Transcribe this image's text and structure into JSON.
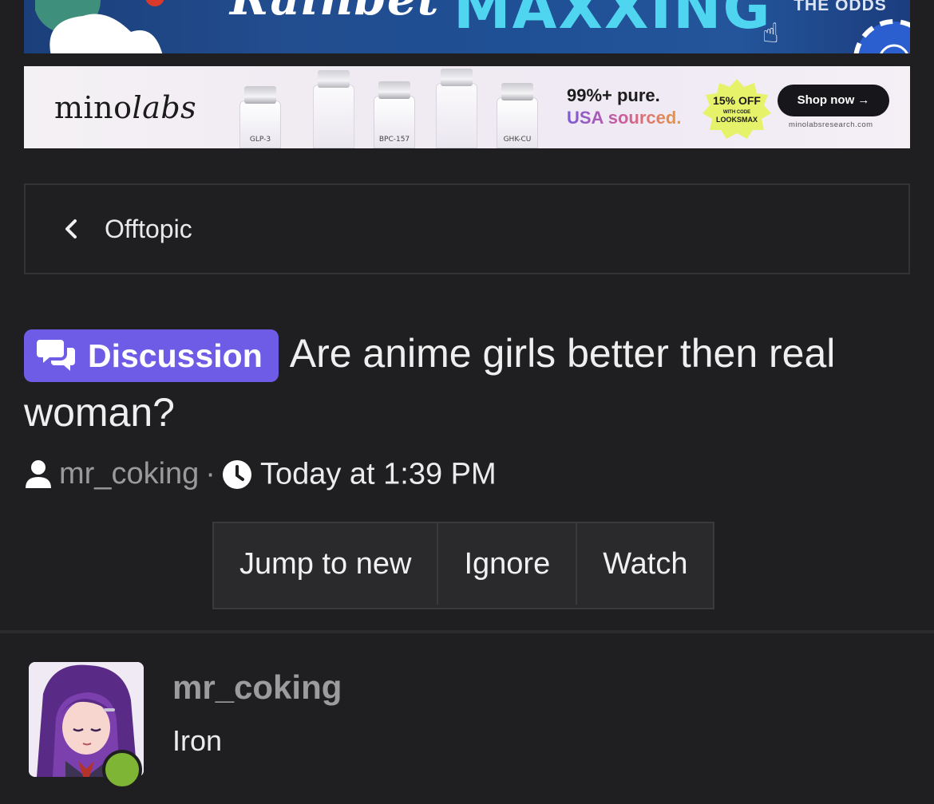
{
  "ads": {
    "top_banner": {
      "brand_text": "Rainbet",
      "headline": "MAXXING",
      "cta": "THE ODDS",
      "colors": {
        "background": "#1f4f94",
        "headline": "#4fd5f0"
      }
    },
    "minolabs_banner": {
      "logo_prefix": "mino",
      "logo_suffix": "labs",
      "vial_labels": [
        "GLP-3",
        "BPC-157",
        "GHK-CU"
      ],
      "tagline_1": "99%+ pure.",
      "tagline_2": "USA sourced.",
      "promo_main": "15% OFF",
      "promo_sub": "WITH CODE",
      "promo_code": "LOOKSMAX",
      "shop_label": "Shop now →",
      "site": "minolabsresearch.com"
    }
  },
  "breadcrumb": {
    "label": "Offtopic",
    "icon": "chevron-left-icon"
  },
  "thread": {
    "prefix_badge": "Discussion",
    "prefix_icon": "comments-icon",
    "title": "Are anime girls better then real woman?",
    "author": "mr_coking",
    "separator": "·",
    "timestamp": "Today at 1:39 PM"
  },
  "actions": {
    "jump_to_new": "Jump to new",
    "ignore": "Ignore",
    "watch": "Watch"
  },
  "post": {
    "username": "mr_coking",
    "rank": "Iron",
    "online": true
  },
  "colors": {
    "page_bg": "#1f1f21",
    "badge_bg": "#6e5ce6",
    "online": "#7fb534",
    "muted_text": "#9a9a9c"
  }
}
